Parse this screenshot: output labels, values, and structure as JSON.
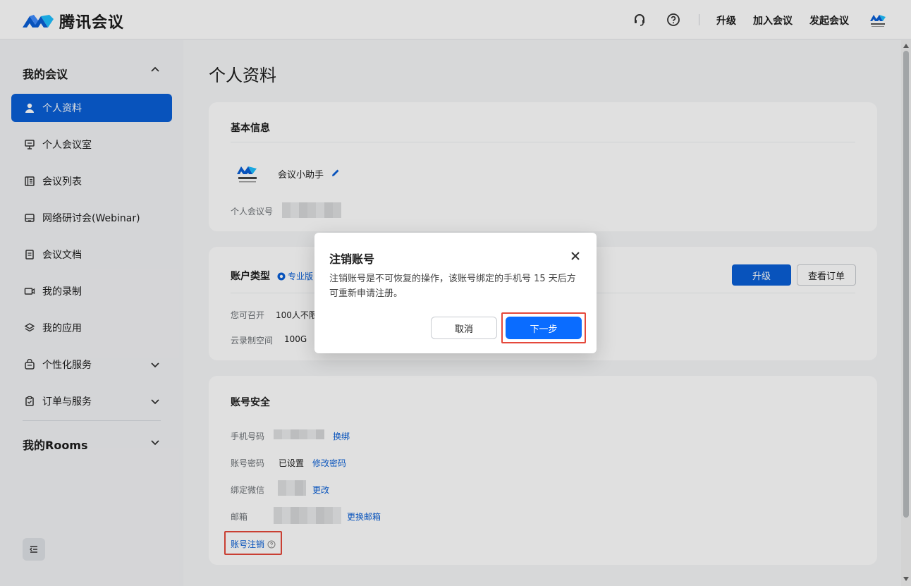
{
  "app": {
    "brand": "腾讯会议",
    "avatar_text": "腾讯会议"
  },
  "header": {
    "upgrade": "升级",
    "join": "加入会议",
    "start": "发起会议"
  },
  "sidebar": {
    "group_my_meetings": "我的会议",
    "items": [
      {
        "label": "个人资料",
        "icon": "user-icon"
      },
      {
        "label": "个人会议室",
        "icon": "monitor-icon"
      },
      {
        "label": "会议列表",
        "icon": "list-icon"
      },
      {
        "label": "网络研讨会(Webinar)",
        "icon": "webinar-icon"
      },
      {
        "label": "会议文档",
        "icon": "document-icon"
      },
      {
        "label": "我的录制",
        "icon": "video-icon"
      },
      {
        "label": "我的应用",
        "icon": "layers-icon"
      },
      {
        "label": "个性化服务",
        "icon": "custom-icon"
      },
      {
        "label": "订单与服务",
        "icon": "clipboard-icon"
      }
    ],
    "group_rooms": "我的Rooms"
  },
  "page": {
    "title": "个人资料"
  },
  "basic_info": {
    "title": "基本信息",
    "nickname": "会议小助手",
    "meeting_id_label": "个人会议号"
  },
  "account_type": {
    "title": "账户类型",
    "badge": "专业版",
    "can_host_label": "您可召开",
    "can_host_value": "100人不限",
    "cloud_label": "云录制空间",
    "cloud_value": "100G",
    "upgrade_btn": "升级",
    "orders_btn": "查看订单"
  },
  "security": {
    "title": "账号安全",
    "phone_label": "手机号码",
    "phone_link": "换绑",
    "password_label": "账号密码",
    "password_value": "已设置",
    "password_link": "修改密码",
    "wechat_label": "绑定微信",
    "wechat_link": "更改",
    "email_label": "邮箱",
    "email_link": "更换邮箱",
    "deregister_link": "账号注销"
  },
  "dialog": {
    "title": "注销账号",
    "body": "注销账号是不可恢复的操作，该账号绑定的手机号 15 天后方可重新申请注册。",
    "cancel": "取消",
    "next": "下一步"
  },
  "colors": {
    "accent": "#0a5fd6",
    "highlight": "#e5483b"
  }
}
